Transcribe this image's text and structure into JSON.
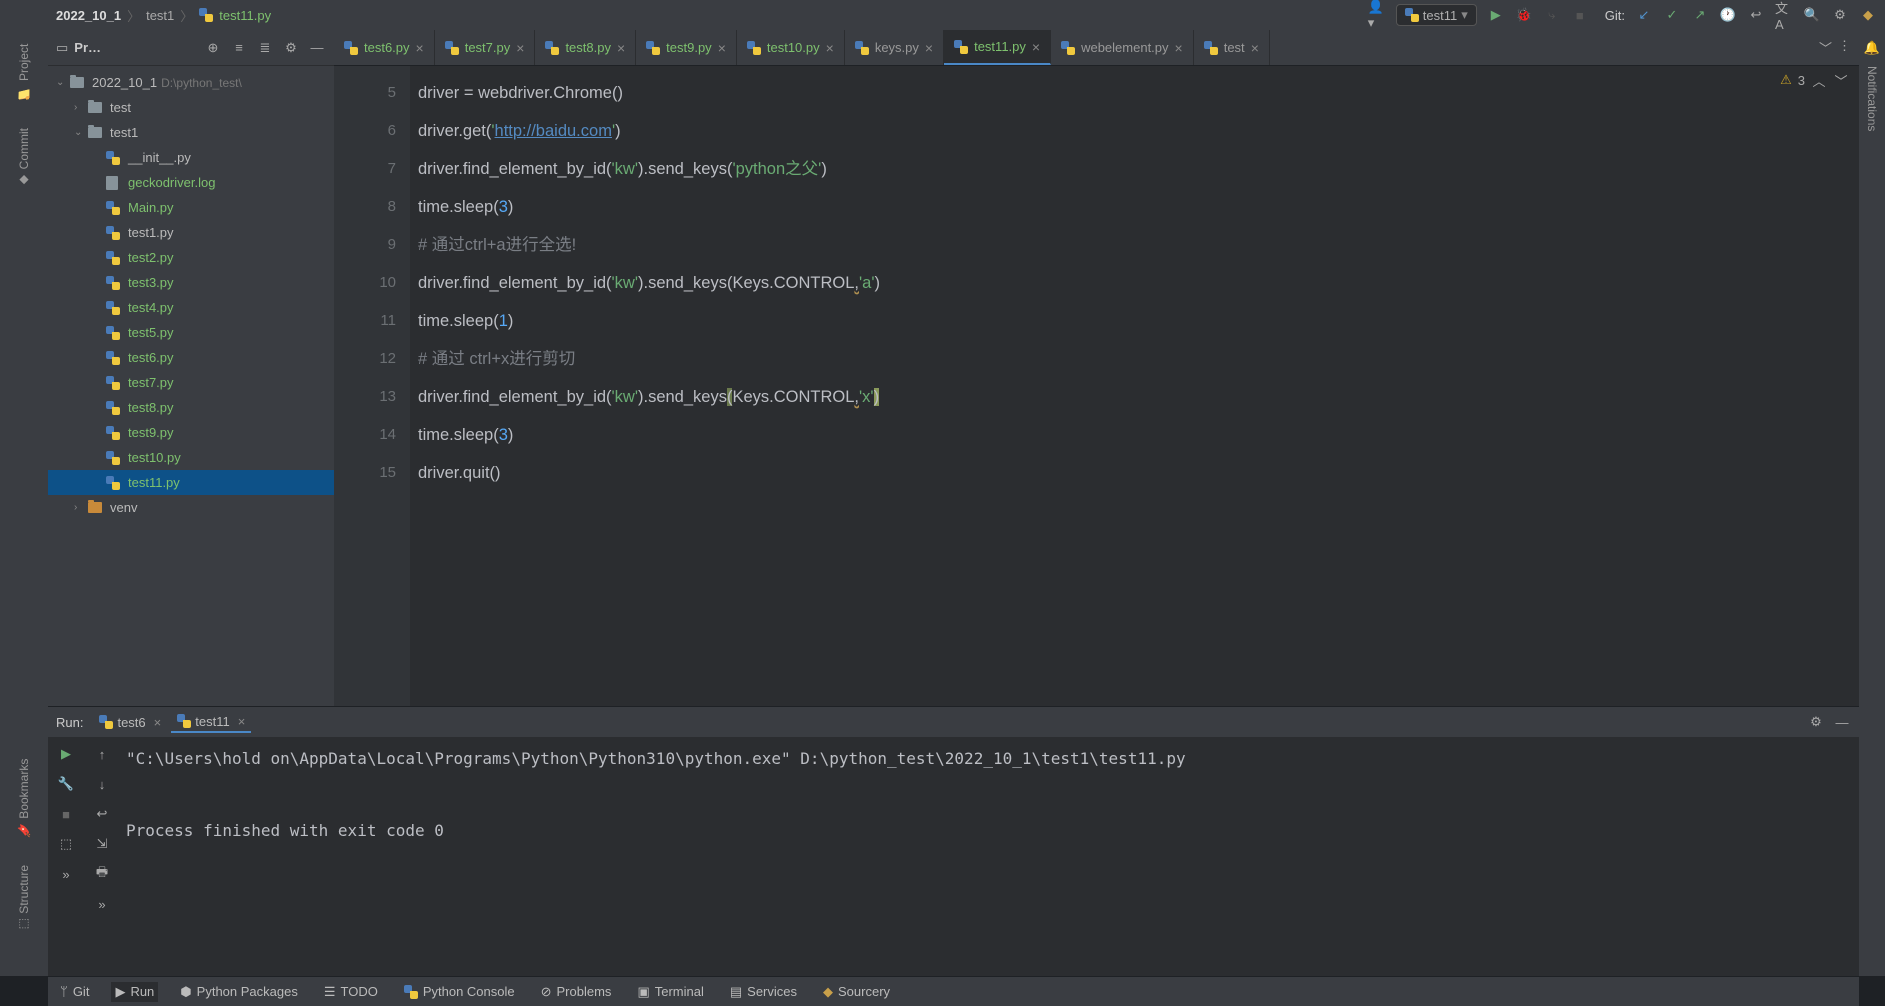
{
  "breadcrumb": {
    "root": "2022_10_1",
    "mid": "test1",
    "file": "test11.py"
  },
  "runConfig": "test11",
  "gitLabel": "Git:",
  "leftRail": {
    "project": "Project",
    "commit": "Commit",
    "bookmarks": "Bookmarks",
    "structure": "Structure"
  },
  "rightRail": {
    "notifications": "Notifications"
  },
  "projHeader": {
    "title": "Pr…"
  },
  "tree": {
    "root": {
      "name": "2022_10_1",
      "path": "D:\\python_test\\"
    },
    "test": "test",
    "test1": "test1",
    "files": [
      "__init__.py",
      "geckodriver.log",
      "Main.py",
      "test1.py",
      "test2.py",
      "test3.py",
      "test4.py",
      "test5.py",
      "test6.py",
      "test7.py",
      "test8.py",
      "test9.py",
      "test10.py",
      "test11.py"
    ],
    "venv": "venv"
  },
  "tabs": [
    "test6.py",
    "test7.py",
    "test8.py",
    "test9.py",
    "test10.py",
    "keys.py",
    "test11.py",
    "webelement.py",
    "test"
  ],
  "activeTab": 6,
  "indicators": {
    "warnCount": "3"
  },
  "gutter": [
    "5",
    "6",
    "7",
    "8",
    "9",
    "10",
    "11",
    "12",
    "13",
    "14",
    "15"
  ],
  "code": {
    "lines": [
      [
        {
          "t": "driver "
        },
        {
          "t": "="
        },
        {
          "t": " webdriver.Chrome()"
        }
      ],
      [
        {
          "t": "driver.get("
        },
        {
          "c": "str",
          "t": "'"
        },
        {
          "c": "link",
          "t": "http://baidu.com"
        },
        {
          "c": "str",
          "t": "'"
        },
        {
          "t": ")"
        }
      ],
      [
        {
          "t": "driver.find_element_by_id("
        },
        {
          "c": "str",
          "t": "'kw'"
        },
        {
          "t": ").send_keys("
        },
        {
          "c": "str",
          "t": "'python之父'"
        },
        {
          "t": ")"
        }
      ],
      [
        {
          "t": "time.sleep("
        },
        {
          "c": "num",
          "t": "3"
        },
        {
          "t": ")"
        }
      ],
      [
        {
          "c": "cmt",
          "t": "# 通过ctrl+a进行全选!"
        }
      ],
      [
        {
          "t": "driver.find_element_by_id("
        },
        {
          "c": "str",
          "t": "'kw'"
        },
        {
          "t": ").send_keys(Keys.CONTROL"
        },
        {
          "c": "warn",
          "t": ","
        },
        {
          "c": "str",
          "t": "'a'"
        },
        {
          "t": ")"
        }
      ],
      [
        {
          "t": "time.sleep("
        },
        {
          "c": "num",
          "t": "1"
        },
        {
          "t": ")"
        }
      ],
      [
        {
          "c": "cmt",
          "t": "# 通过 ctrl+x进行剪切"
        }
      ],
      [
        {
          "t": "driver.find_element_by_id("
        },
        {
          "c": "str",
          "t": "'kw'"
        },
        {
          "t": ").send_keys"
        },
        {
          "c": "hl-bracket",
          "t": "("
        },
        {
          "t": "Keys.CONTROL"
        },
        {
          "c": "warn",
          "t": ","
        },
        {
          "c": "str",
          "t": "'x'"
        },
        {
          "c": "hl-cursor",
          "t": ")"
        }
      ],
      [
        {
          "t": "time.sleep("
        },
        {
          "c": "num",
          "t": "3"
        },
        {
          "t": ")"
        }
      ],
      [
        {
          "t": "driver.quit()"
        }
      ]
    ]
  },
  "run": {
    "title": "Run:",
    "tabs": [
      "test6",
      "test11"
    ],
    "activeTab": 1,
    "output": "\"C:\\Users\\hold on\\AppData\\Local\\Programs\\Python\\Python310\\python.exe\" D:\\python_test\\2022_10_1\\test1\\test11.py\n\n\nProcess finished with exit code 0"
  },
  "bottomBar": {
    "git": "Git",
    "run": "Run",
    "pyPkg": "Python Packages",
    "todo": "TODO",
    "pyConsole": "Python Console",
    "problems": "Problems",
    "terminal": "Terminal",
    "services": "Services",
    "sourcery": "Sourcery"
  },
  "hlTabs": [
    0,
    1,
    2,
    3,
    4,
    6
  ],
  "hlFiles": [
    1,
    2,
    4,
    5,
    6,
    7,
    8,
    9,
    10,
    11,
    12,
    13
  ]
}
